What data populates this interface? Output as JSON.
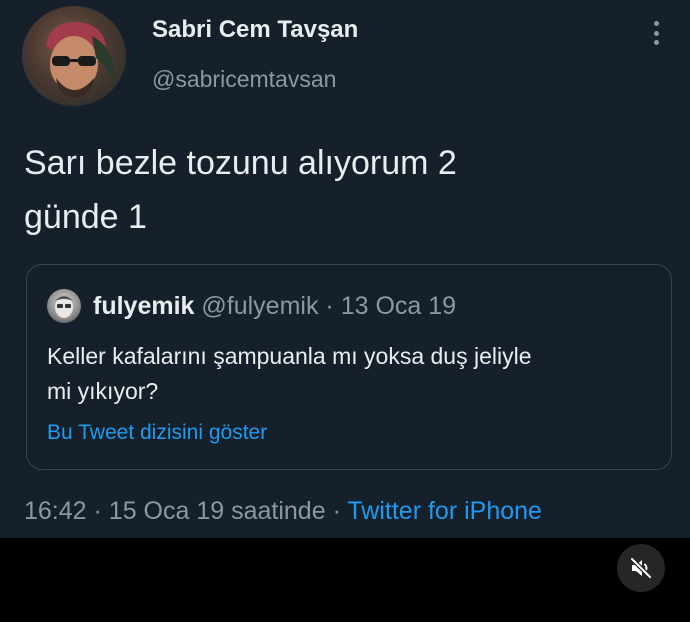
{
  "author": {
    "display_name": "Sabri Cem Tavşan",
    "handle": "@sabricemtavsan"
  },
  "tweet": {
    "text_line1": "Sarı bezle tozunu alıyorum 2",
    "text_line2": "günde 1"
  },
  "quoted_tweet": {
    "name": "fulyemik",
    "handle": "@fulyemik",
    "separator": "·",
    "date": "13 Oca 19",
    "text_line1": "Keller kafalarını şampuanla mı yoksa duş jeliyle",
    "text_line2": "mi yıkıyor?",
    "thread_link": "Bu Tweet dizisini göster"
  },
  "meta": {
    "time": "16:42",
    "separator": "·",
    "date_text": "15 Oca 19 saatinde",
    "separator2": "·",
    "source": "Twitter for iPhone"
  },
  "icons": {
    "more": "more-vertical-icon",
    "mute": "speaker-muted-icon"
  },
  "colors": {
    "background": "#15202b",
    "text": "#e9edf0",
    "muted": "#8899a6",
    "link": "#1d9bf0",
    "border": "#38444d"
  }
}
